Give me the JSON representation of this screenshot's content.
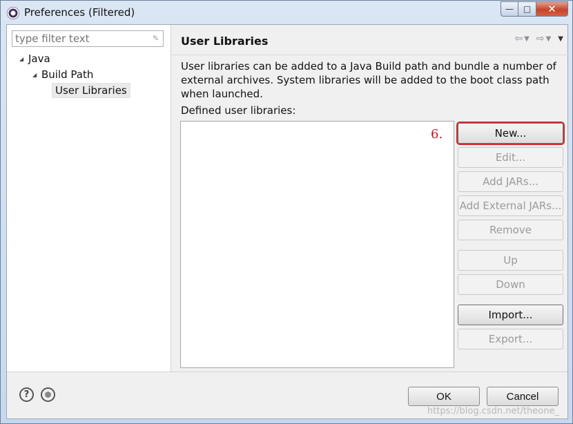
{
  "window": {
    "title": "Preferences (Filtered)",
    "controls": {
      "minimize": "—",
      "maximize": "□",
      "close": "✕"
    }
  },
  "left_pane": {
    "filter": {
      "placeholder": "type filter text",
      "value": ""
    },
    "tree": [
      {
        "label": "Java",
        "expanded": true,
        "level": 0
      },
      {
        "label": "Build Path",
        "expanded": true,
        "level": 1
      },
      {
        "label": "User Libraries",
        "selected": true,
        "level": 2
      }
    ]
  },
  "page": {
    "title": "User Libraries",
    "nav_icons": [
      "back-arrow-icon",
      "chevron-down-icon",
      "forward-arrow-icon",
      "chevron-down-icon",
      "view-menu-icon"
    ],
    "description": "User libraries can be added to a Java Build path and bundle a number of external archives. System libraries will be added to the boot class path when launched.",
    "list_label": "Defined user libraries:",
    "annotation": "6.",
    "buttons": [
      {
        "label": "New...",
        "enabled": true,
        "highlighted": true
      },
      {
        "label": "Edit...",
        "enabled": false
      },
      {
        "label": "Add JARs...",
        "enabled": false
      },
      {
        "label": "Add External JARs...",
        "enabled": false
      },
      {
        "label": "Remove",
        "enabled": false
      },
      {
        "label": "Up",
        "enabled": false
      },
      {
        "label": "Down",
        "enabled": false
      },
      {
        "label": "Import...",
        "enabled": true
      },
      {
        "label": "Export...",
        "enabled": false
      }
    ]
  },
  "footer": {
    "ok_label": "OK",
    "cancel_label": "Cancel",
    "help_icon": "?",
    "watermark": "https://blog.csdn.net/theone_"
  },
  "colors": {
    "annotation_red": "#c0161b",
    "highlight_border": "#cf2b2b"
  }
}
